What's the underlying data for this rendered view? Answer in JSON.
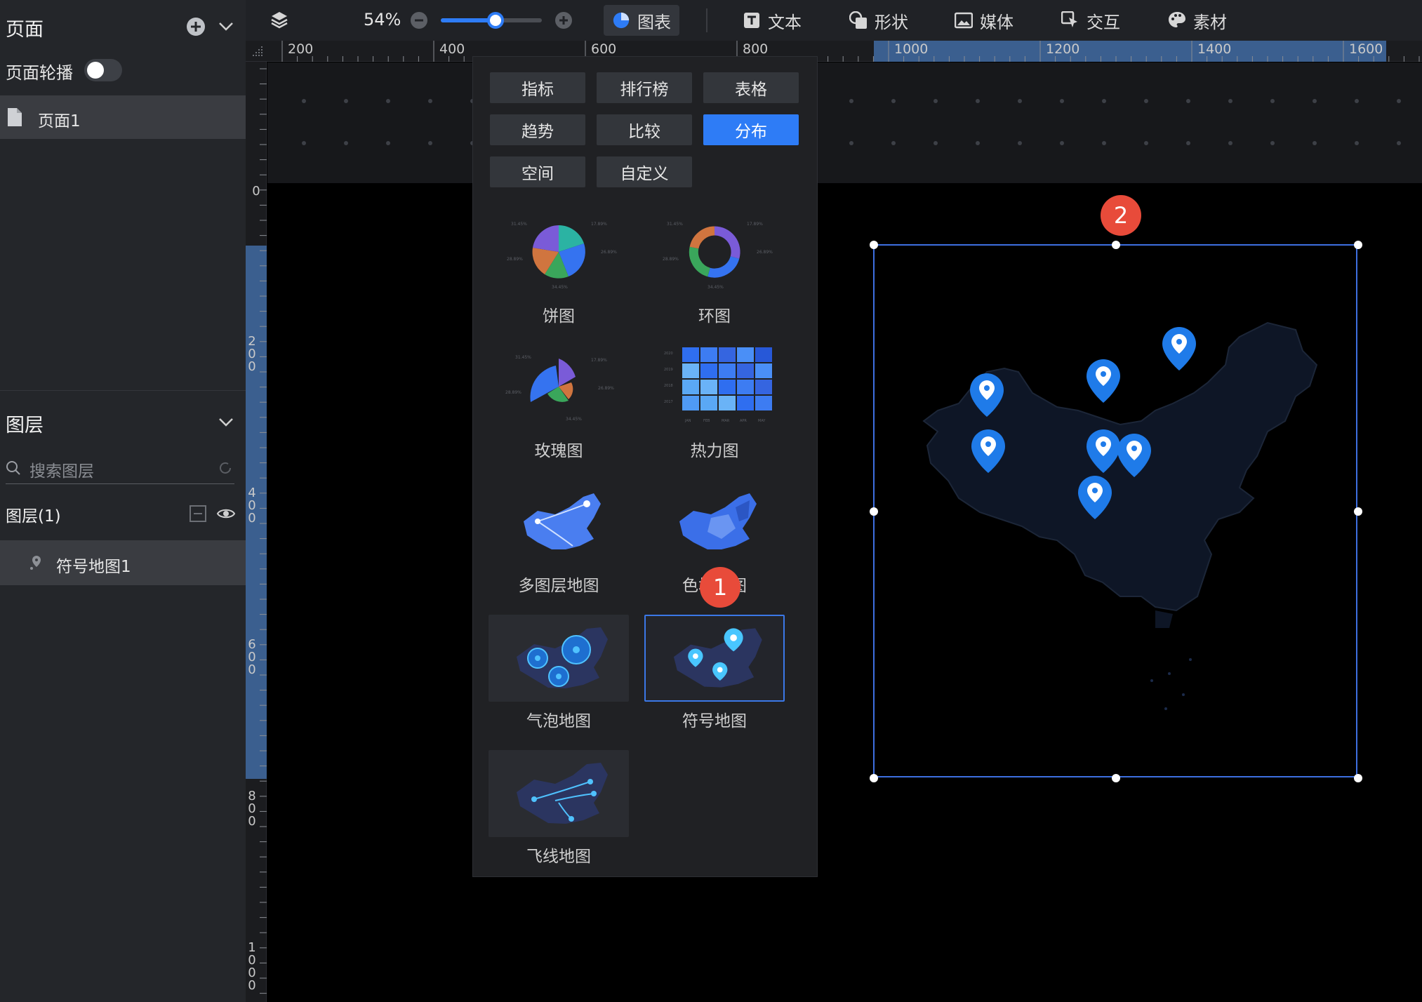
{
  "left_panel": {
    "pages_title": "页面",
    "carousel_label": "页面轮播",
    "carousel_on": false,
    "page_item": "页面1",
    "layers_title": "图层",
    "search_placeholder": "搜索图层",
    "layers_count_label": "图层(1)",
    "layer_item": "符号地图1"
  },
  "toolbar": {
    "zoom_value": "54%",
    "zoom_level": 0.54,
    "tools": [
      {
        "label": "图表",
        "icon": "chart-pie-icon",
        "active": true
      },
      {
        "label": "文本",
        "icon": "text-icon"
      },
      {
        "label": "形状",
        "icon": "shape-icon"
      },
      {
        "label": "媒体",
        "icon": "media-icon"
      },
      {
        "label": "交互",
        "icon": "interaction-icon"
      },
      {
        "label": "素材",
        "icon": "palette-icon"
      }
    ]
  },
  "ruler": {
    "horizontal": [
      "200",
      "400",
      "600",
      "800",
      "1000",
      "1200",
      "1400",
      "1600"
    ],
    "vertical": [
      "0",
      "200",
      "400",
      "600",
      "800",
      "1000"
    ]
  },
  "chart_menu": {
    "categories": [
      "指标",
      "排行榜",
      "表格",
      "趋势",
      "比较",
      "分布",
      "空间",
      "自定义"
    ],
    "active_category": "分布",
    "charts": [
      "饼图",
      "环图",
      "玫瑰图",
      "热力图",
      "多图层地图",
      "色块地图",
      "气泡地图",
      "符号地图",
      "飞线地图"
    ],
    "selected_chart": "符号地图",
    "pie_percents": [
      "31.45%",
      "17.89%",
      "26.89%",
      "34.45%",
      "28.89%"
    ],
    "heatmap_years": [
      "2020",
      "2019",
      "2018",
      "2017"
    ],
    "heatmap_months": [
      "JAN",
      "FEB",
      "MAR",
      "APR",
      "MAY"
    ]
  },
  "badges": [
    "1",
    "2"
  ],
  "colors": {
    "accent": "#2e7cf6",
    "badge": "#e84b3a",
    "pin": "#1f7be9",
    "map_fill": "#0d1524"
  }
}
